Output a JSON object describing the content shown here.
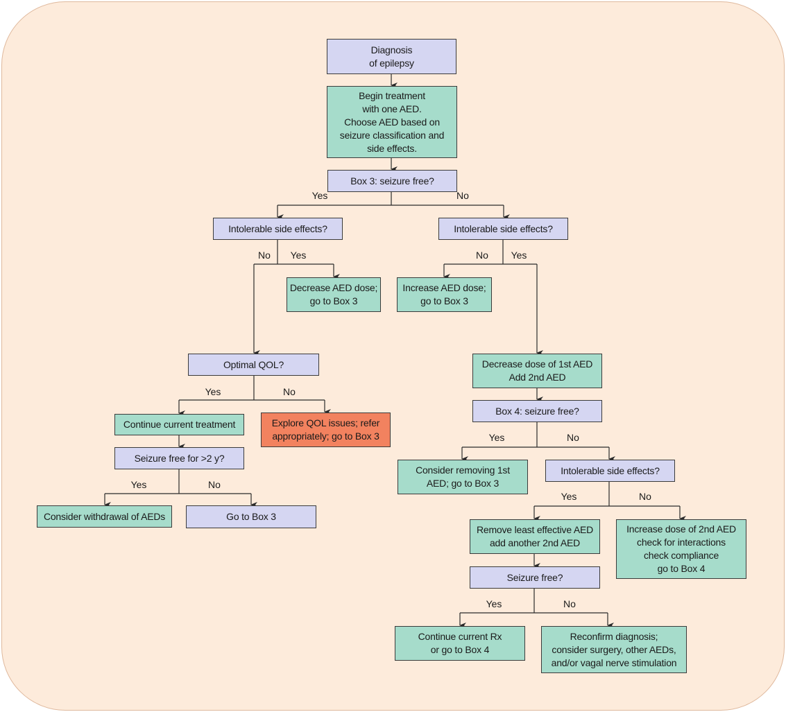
{
  "colors": {
    "background": "#fdebdb",
    "question": "#d5d6f2",
    "action": "#a6dccb",
    "alert": "#f2825f"
  },
  "nodes": [
    {
      "text": "Diagnosis\nof epilepsy"
    },
    {
      "text": "Begin treatment\nwith one AED.\nChoose AED based on\nseizure classification and\nside effects."
    },
    {
      "text": "Box 3: seizure free?"
    },
    {
      "text": "Intolerable side effects?"
    },
    {
      "text": "Intolerable side effects?"
    },
    {
      "text": "Decrease AED dose;\ngo to Box 3"
    },
    {
      "text": "Increase AED dose;\ngo to Box 3"
    },
    {
      "text": "Optimal QOL?"
    },
    {
      "text": "Decrease dose of 1st AED\nAdd 2nd AED"
    },
    {
      "text": "Box 4: seizure free?"
    },
    {
      "text": "Continue current treatment"
    },
    {
      "text": "Explore QOL issues; refer\nappropriately; go to Box 3"
    },
    {
      "text": "Seizure free for >2 y?"
    },
    {
      "text": "Consider removing 1st\nAED; go to Box 3"
    },
    {
      "text": "Intolerable side effects?"
    },
    {
      "text": "Consider withdrawal of AEDs"
    },
    {
      "text": "Go to Box 3"
    },
    {
      "text": "Remove least effective AED\nadd another 2nd AED"
    },
    {
      "text": "Increase dose of 2nd AED\ncheck for interactions\ncheck compliance\ngo to Box 4"
    },
    {
      "text": "Seizure free?"
    },
    {
      "text": "Continue current Rx\nor go to Box 4"
    },
    {
      "text": "Reconfirm diagnosis;\nconsider surgery, other AEDs,\nand/or vagal nerve stimulation"
    }
  ],
  "labels": {
    "yes": "Yes",
    "no": "No"
  }
}
